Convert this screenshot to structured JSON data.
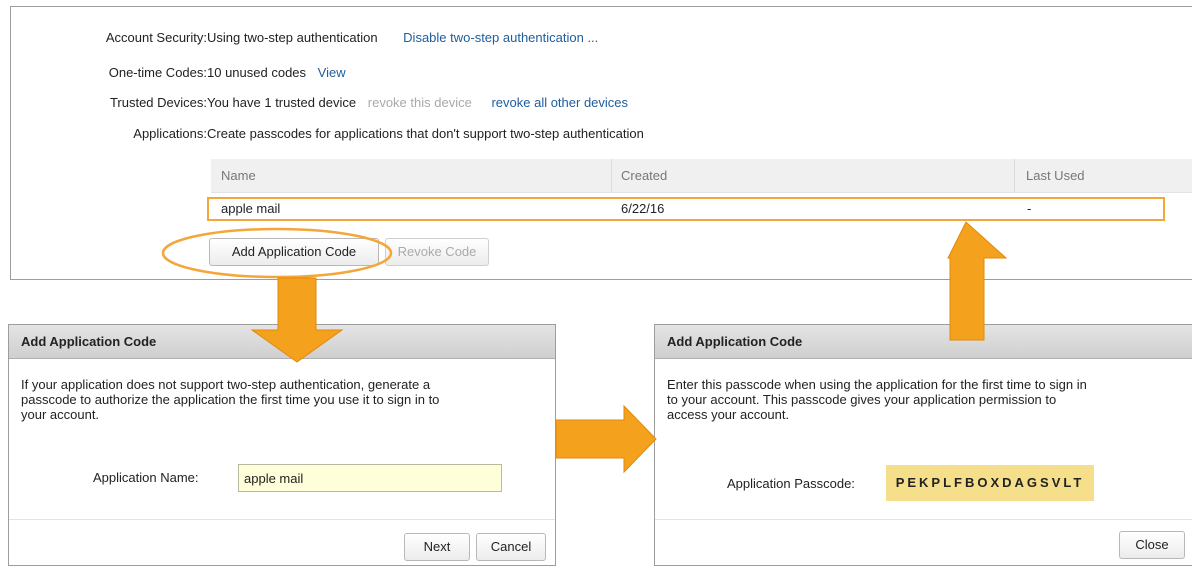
{
  "settings": {
    "account_security": {
      "label": "Account Security:",
      "value": "Using two-step authentication",
      "action": "Disable two-step authentication ..."
    },
    "one_time_codes": {
      "label": "One-time Codes:",
      "value": "10 unused codes",
      "action": "View"
    },
    "trusted_devices": {
      "label": "Trusted Devices:",
      "value": "You have 1 trusted device",
      "revoke_this": "revoke this device",
      "revoke_all": "revoke all other devices"
    },
    "applications": {
      "label": "Applications:",
      "value": "Create passcodes for applications that don't support two-step authentication"
    }
  },
  "table": {
    "headers": [
      "Name",
      "Created",
      "Last Used"
    ],
    "rows": [
      {
        "name": "apple mail",
        "created": "6/22/16",
        "last_used": "-"
      }
    ]
  },
  "buttons": {
    "add_application_code": "Add Application Code",
    "revoke_code": "Revoke Code"
  },
  "dialog_left": {
    "title": "Add Application Code",
    "description_lines": [
      "If your application does not support two-step authentication, generate a",
      "passcode to authorize the application the first time you use it to sign in to",
      "your account."
    ],
    "field_label": "Application Name:",
    "field_value": "apple mail",
    "next_button": "Next",
    "cancel_button": "Cancel"
  },
  "dialog_right": {
    "title": "Add Application Code",
    "description_lines": [
      "Enter this passcode when using the application for the first time to sign in",
      "to your account. This passcode gives your application permission to",
      "access your account."
    ],
    "passcode_label": "Application Passcode:",
    "passcode": "PEKPLFBOXDAGSVLT",
    "close_button": "Close"
  },
  "annotation_color": "#f4a63a"
}
